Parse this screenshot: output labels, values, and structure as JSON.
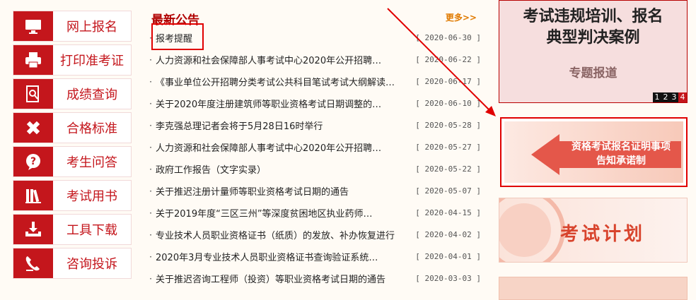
{
  "menu": [
    {
      "label": "网上报名",
      "icon": "monitor-icon"
    },
    {
      "label": "打印准考证",
      "icon": "printer-icon"
    },
    {
      "label": "成绩查询",
      "icon": "search-document-icon"
    },
    {
      "label": "合格标准",
      "icon": "ruler-pencil-icon"
    },
    {
      "label": "考生问答",
      "icon": "question-bubble-icon"
    },
    {
      "label": "考试用书",
      "icon": "books-icon"
    },
    {
      "label": "工具下载",
      "icon": "download-tray-icon"
    },
    {
      "label": "咨询投诉",
      "icon": "phone-icon"
    }
  ],
  "news": {
    "title": "最新公告",
    "more": "更多>>",
    "bullet": "·",
    "items": [
      {
        "text": "报考提醒",
        "date": "[ 2020-06-30 ]"
      },
      {
        "text": "人力资源和社会保障部人事考试中心2020年公开招聘…",
        "date": "[ 2020-06-22 ]"
      },
      {
        "text": "《事业单位公开招聘分类考试公共科目笔试考试大纲解读…",
        "date": "[ 2020-06-17 ]"
      },
      {
        "text": "关于2020年度注册建筑师等职业资格考试日期调整的…",
        "date": "[ 2020-06-10 ]"
      },
      {
        "text": "李克强总理记者会将于5月28日16时举行",
        "date": "[ 2020-05-28 ]"
      },
      {
        "text": "人力资源和社会保障部人事考试中心2020年公开招聘…",
        "date": "[ 2020-05-27 ]"
      },
      {
        "text": "政府工作报告（文字实录）",
        "date": "[ 2020-05-22 ]"
      },
      {
        "text": "关于推迟注册计量师等职业资格考试日期的通告",
        "date": "[ 2020-05-07 ]"
      },
      {
        "text": "关于2019年度“三区三州”等深度贫困地区执业药师…",
        "date": "[ 2020-04-15 ]"
      },
      {
        "text": "专业技术人员职业资格证书（纸质）的发放、补办恢复进行",
        "date": "[ 2020-04-02 ]"
      },
      {
        "text": "2020年3月专业技术人员职业资格证书查询验证系统…",
        "date": "[ 2020-04-01 ]"
      },
      {
        "text": "关于推迟咨询工程师（投资）等职业资格考试日期的通告",
        "date": "[ 2020-03-03 ]"
      }
    ]
  },
  "banner": {
    "line1": "考试违规培训、报名",
    "line2": "典型判决案例",
    "sub": "专题报道",
    "pages": [
      "1",
      "2",
      "3",
      "4"
    ],
    "active_page": "4"
  },
  "notice_card": {
    "line1": "资格考试报名证明事项",
    "line2": "告知承诺制"
  },
  "plan_card": {
    "text": "考试计划"
  },
  "colors": {
    "brand": "#c4161c",
    "highlight": "#e00000",
    "more": "#e07a00"
  }
}
